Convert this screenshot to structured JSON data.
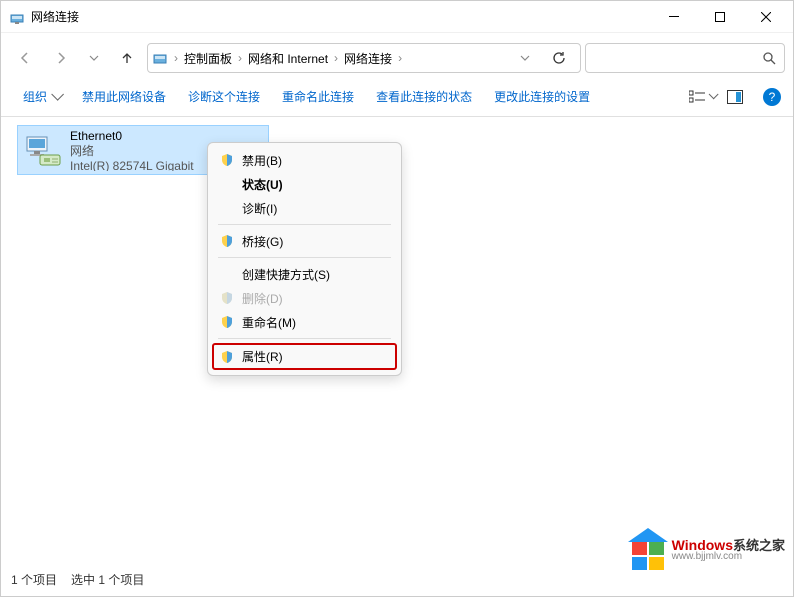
{
  "window": {
    "title": "网络连接"
  },
  "breadcrumb": [
    "控制面板",
    "网络和 Internet",
    "网络连接"
  ],
  "toolbar": {
    "org": "组织",
    "disable": "禁用此网络设备",
    "diagnose": "诊断这个连接",
    "rename": "重命名此连接",
    "status": "查看此连接的状态",
    "settings": "更改此连接的设置"
  },
  "adapter": {
    "name": "Ethernet0",
    "state": "网络",
    "driver": "Intel(R) 82574L Gigabit"
  },
  "contextmenu": {
    "disable": "禁用(B)",
    "status": "状态(U)",
    "diagnose": "诊断(I)",
    "bridge": "桥接(G)",
    "shortcut": "创建快捷方式(S)",
    "delete": "删除(D)",
    "rename": "重命名(M)",
    "properties": "属性(R)"
  },
  "statusbar": {
    "count": "1 个项目",
    "selected": "选中 1 个项目"
  },
  "watermark": {
    "brand": "Windows",
    "cn": "系统之家",
    "url": "www.bjjmlv.com"
  }
}
